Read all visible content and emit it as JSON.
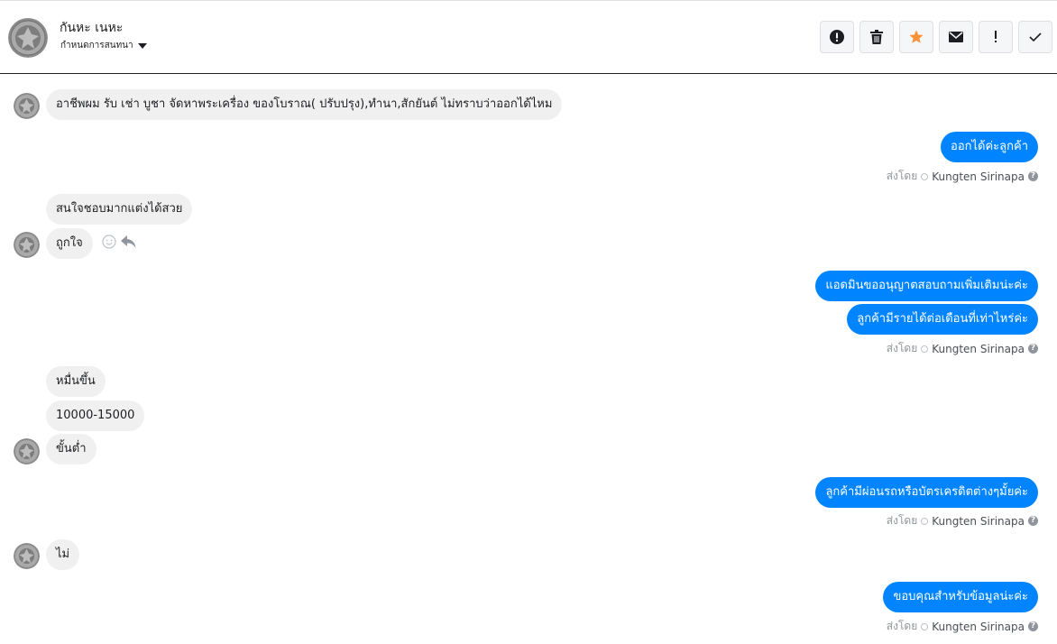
{
  "header": {
    "contact_name": "กันหะ เนหะ",
    "subtitle": "กำหนดการสนทนา",
    "toolbar": [
      {
        "icon": "alert-circle-icon"
      },
      {
        "icon": "trash-icon"
      },
      {
        "icon": "star-icon"
      },
      {
        "icon": "envelope-icon"
      },
      {
        "icon": "exclamation-icon"
      },
      {
        "icon": "check-icon"
      }
    ]
  },
  "colors": {
    "outgoing_bubble": "#0084ff",
    "incoming_bubble": "#f1f0f0",
    "star": "#f7923a"
  },
  "messages": {
    "m1": "อาชีพผม รับ เช่า บูชา จัดหาพระเครื่อง ของโบราณ( ปรับปรุง),ทำนา,สักยันต์ ไม่ทราบว่าออกได้ไหม",
    "m2": "ออกได้ค่ะลูกค้า",
    "m3": "สนใจชอบมากแต่งได้สวย",
    "m4": "ถูกใจ",
    "m5": "แอดมินขออนุญาตสอบถามเพิ่มเติมน่ะค่ะ",
    "m6": "ลูกค้ามีรายได้ต่อเดือนที่เท่าไหร่ค่ะ",
    "m7": "หมื่นขึ้น",
    "m8": "10000-15000",
    "m9": "ขั้นต่ำ",
    "m10": "ลูกค้ามีผ่อนรถหรือบัตรเครดิตต่างๆมั้ยค่ะ",
    "m11": "ไม่",
    "m12": "ขอบคุณสำหรับข้อมูลน่ะค่ะ"
  },
  "sent_by": {
    "prefix": "ส่งโดย",
    "agent": "Kungten Sirinapa"
  }
}
